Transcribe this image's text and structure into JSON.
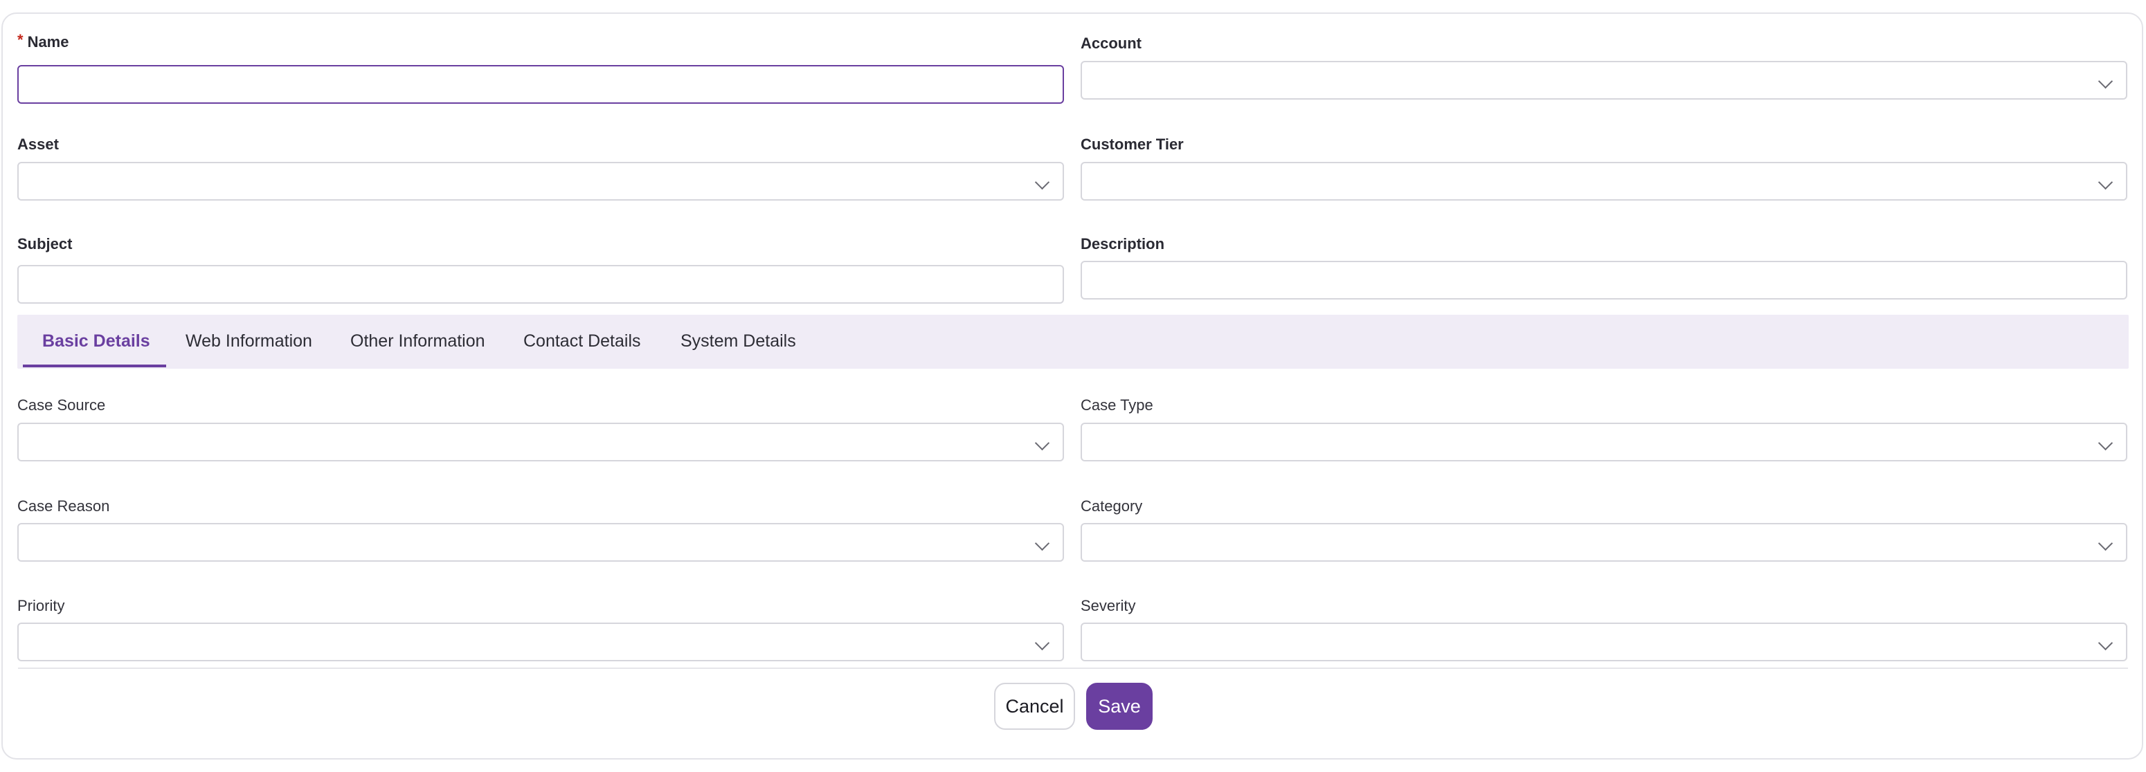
{
  "top_fields": {
    "name": {
      "label": "Name",
      "required_mark": "*",
      "value": ""
    },
    "account": {
      "label": "Account",
      "value": ""
    },
    "asset": {
      "label": "Asset",
      "value": ""
    },
    "customer_tier": {
      "label": "Customer Tier",
      "value": ""
    },
    "subject": {
      "label": "Subject",
      "value": ""
    },
    "description": {
      "label": "Description",
      "value": ""
    }
  },
  "tabs": [
    {
      "label": "Basic Details",
      "active": true
    },
    {
      "label": "Web Information",
      "active": false
    },
    {
      "label": "Other Information",
      "active": false
    },
    {
      "label": "Contact Details",
      "active": false
    },
    {
      "label": "System Details",
      "active": false
    }
  ],
  "basic_details": {
    "case_source": {
      "label": "Case Source",
      "value": ""
    },
    "case_type": {
      "label": "Case Type",
      "value": ""
    },
    "case_reason": {
      "label": "Case Reason",
      "value": ""
    },
    "category": {
      "label": "Category",
      "value": ""
    },
    "priority": {
      "label": "Priority",
      "value": ""
    },
    "severity": {
      "label": "Severity",
      "value": ""
    }
  },
  "actions": {
    "cancel_label": "Cancel",
    "save_label": "Save"
  },
  "icons": {
    "dropdown": "chevron-down-icon"
  },
  "colors": {
    "accent": "#6a3fa0",
    "tab_background": "#f0ecf6",
    "required": "#c4281c"
  }
}
